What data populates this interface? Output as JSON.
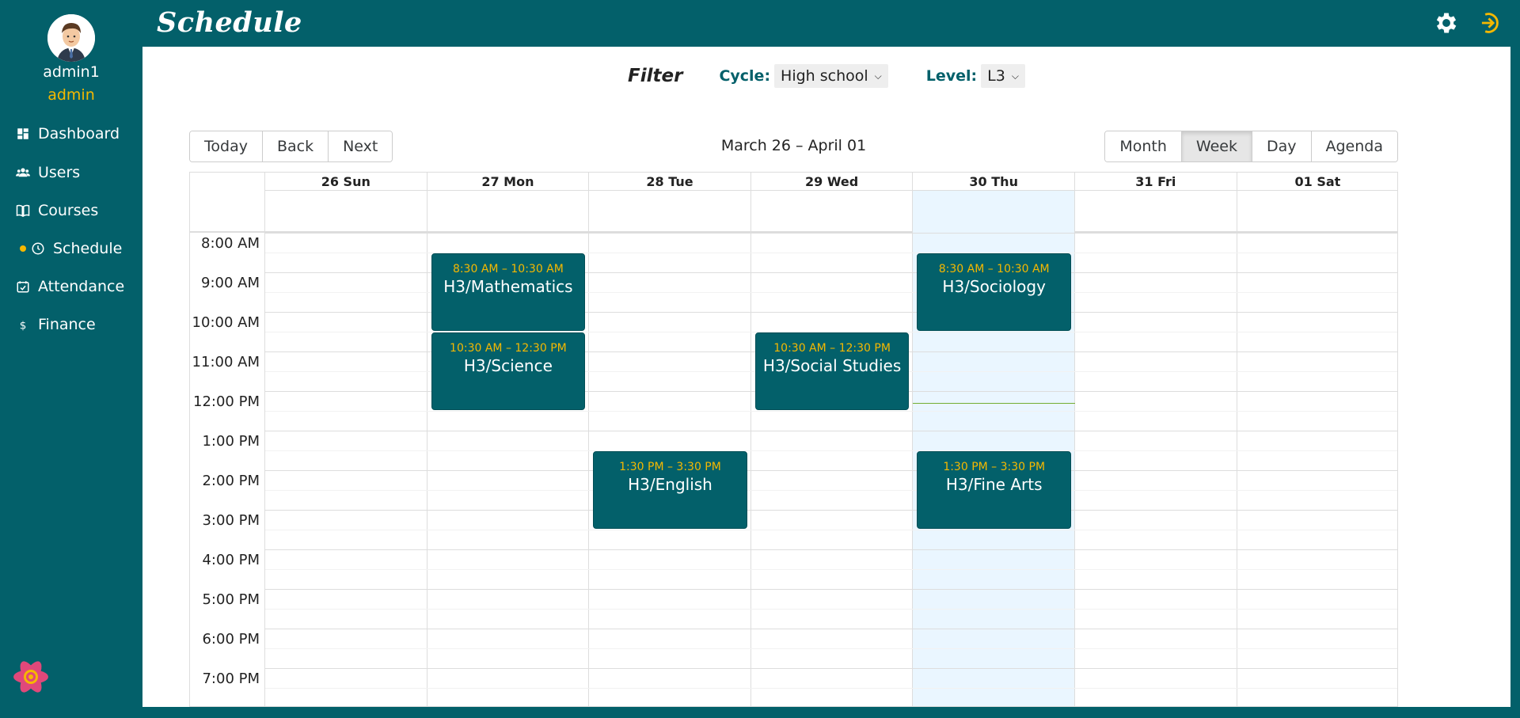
{
  "sidebar": {
    "username": "admin1",
    "role": "admin",
    "items": [
      {
        "label": "Dashboard",
        "icon": "dashboard-icon"
      },
      {
        "label": "Users",
        "icon": "users-icon"
      },
      {
        "label": "Courses",
        "icon": "book-icon"
      },
      {
        "label": "Schedule",
        "icon": "clock-icon",
        "active": true
      },
      {
        "label": "Attendance",
        "icon": "calendar-check-icon"
      },
      {
        "label": "Finance",
        "icon": "dollar-icon"
      }
    ]
  },
  "header": {
    "title": "Schedule",
    "icons": [
      "gear-icon",
      "logout-icon"
    ]
  },
  "filter": {
    "title": "Filter",
    "cycle_label": "Cycle:",
    "cycle_value": "High school",
    "level_label": "Level:",
    "level_value": "L3"
  },
  "toolbar": {
    "nav": [
      "Today",
      "Back",
      "Next"
    ],
    "range": "March 26 – April 01",
    "views": [
      "Month",
      "Week",
      "Day",
      "Agenda"
    ],
    "active_view": "Week"
  },
  "calendar": {
    "days": [
      "26 Sun",
      "27 Mon",
      "28 Tue",
      "29 Wed",
      "30 Thu",
      "31 Fri",
      "01 Sat"
    ],
    "today": "30 Thu",
    "hours": [
      "8:00 AM",
      "9:00 AM",
      "10:00 AM",
      "11:00 AM",
      "12:00 PM",
      "1:00 PM",
      "2:00 PM",
      "3:00 PM",
      "4:00 PM",
      "5:00 PM",
      "6:00 PM",
      "7:00 PM"
    ],
    "events": [
      {
        "day": "27 Mon",
        "time": "8:30 AM – 10:30 AM",
        "title": "H3/Mathematics"
      },
      {
        "day": "27 Mon",
        "time": "10:30 AM – 12:30 PM",
        "title": "H3/Science"
      },
      {
        "day": "28 Tue",
        "time": "1:30 PM – 3:30 PM",
        "title": "H3/English"
      },
      {
        "day": "29 Wed",
        "time": "10:30 AM – 12:30 PM",
        "title": "H3/Social Studies"
      },
      {
        "day": "30 Thu",
        "time": "8:30 AM – 10:30 AM",
        "title": "H3/Sociology"
      },
      {
        "day": "30 Thu",
        "time": "1:30 PM – 3:30 PM",
        "title": "H3/Fine Arts"
      }
    ]
  },
  "colors": {
    "primary": "#03606a",
    "accent": "#f5b800",
    "today_bg": "#eaf6ff"
  }
}
